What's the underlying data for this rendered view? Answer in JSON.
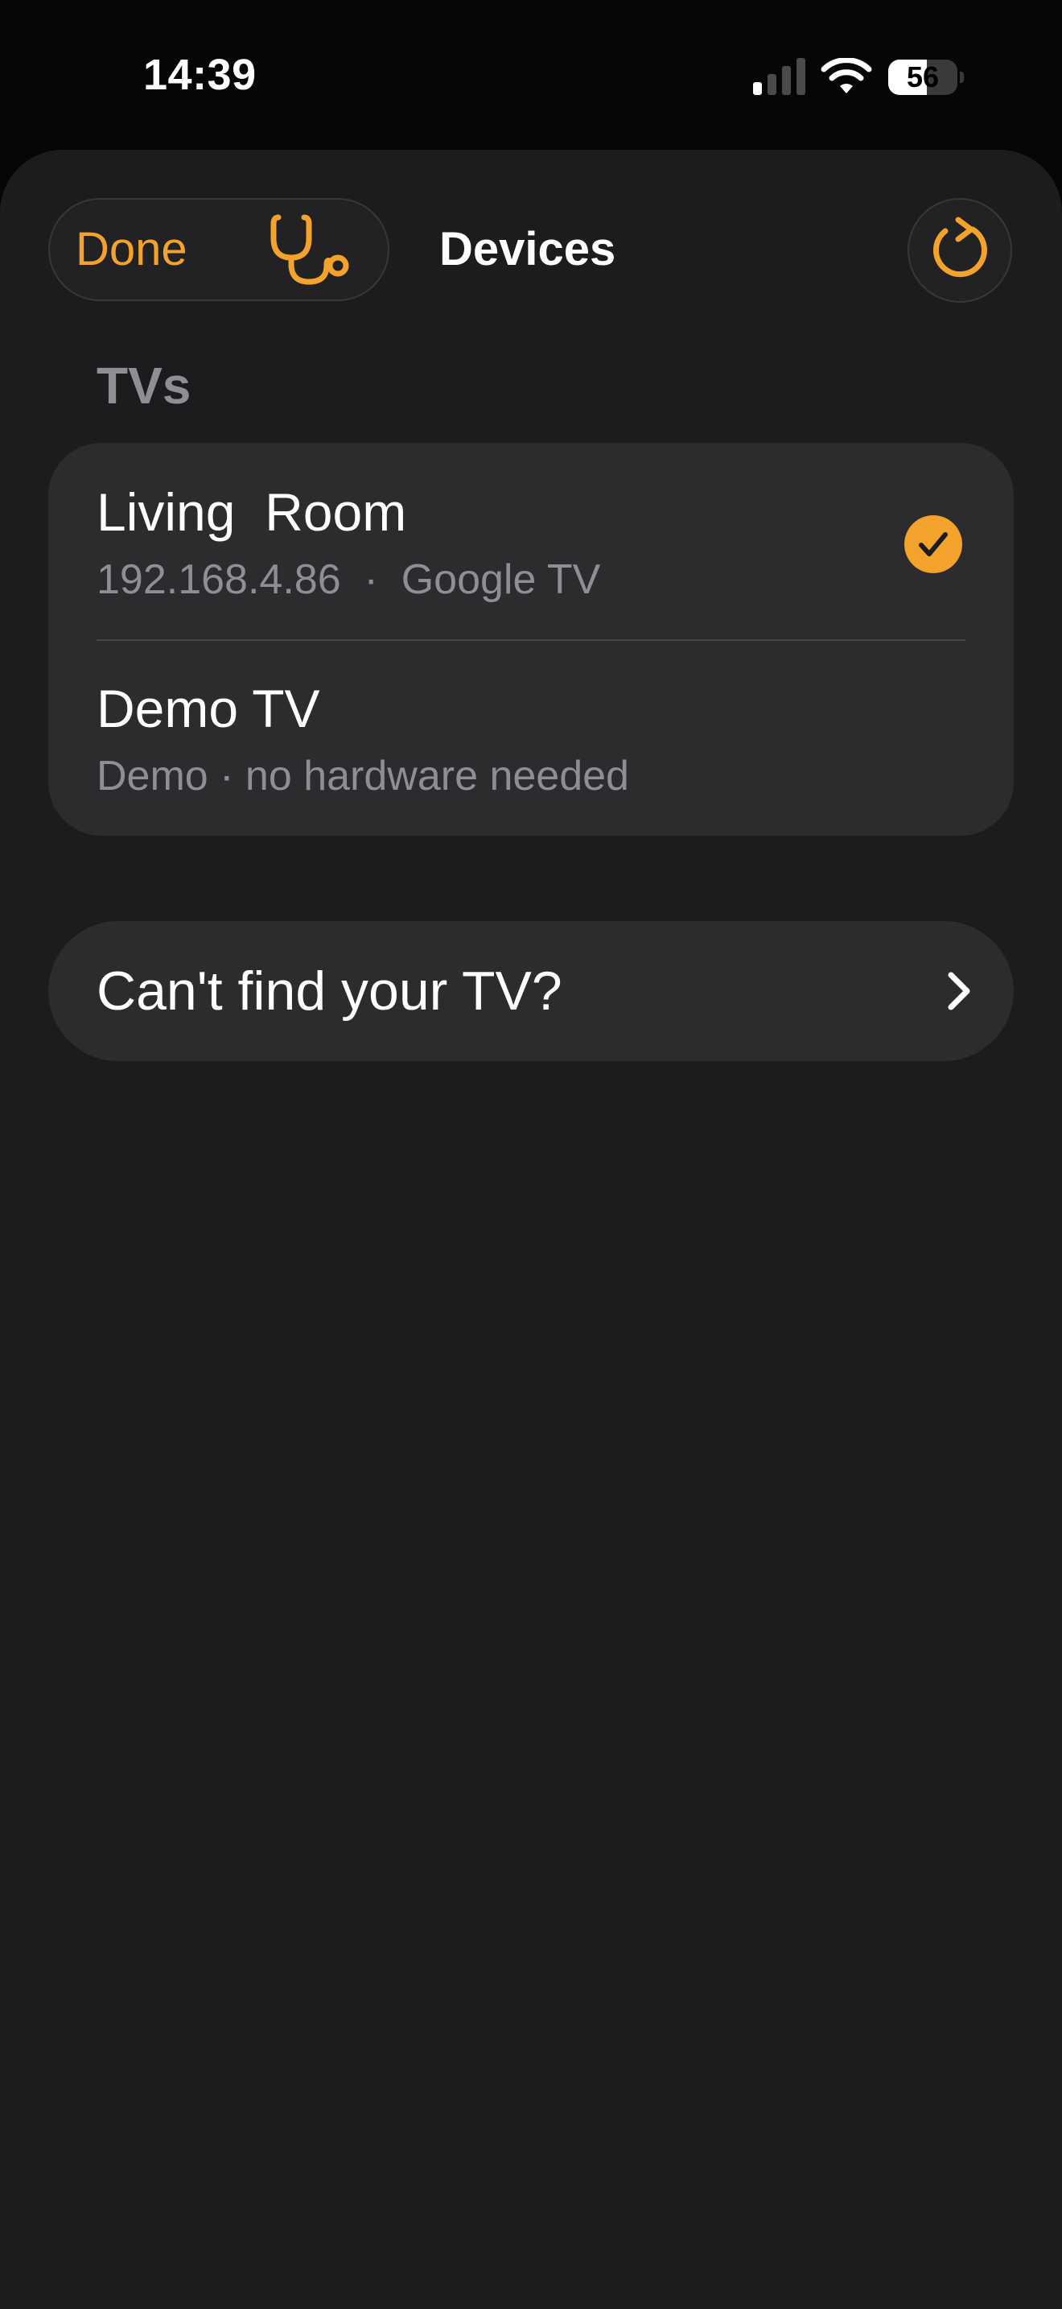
{
  "status_bar": {
    "time": "14:39",
    "battery_level": "56",
    "battery_fraction": 0.56,
    "icons": [
      "signal-icon",
      "wifi-icon",
      "battery-icon"
    ]
  },
  "header": {
    "done_label": "Done",
    "title": "Devices",
    "diagnostics_icon": "stethoscope-icon",
    "refresh_icon": "refresh-icon"
  },
  "tvs_section": {
    "header": "TVs",
    "items": [
      {
        "name": "Living  Room",
        "detail": "192.168.4.86  ·  Google TV",
        "selected": true
      },
      {
        "name": "Demo TV",
        "detail": "Demo · no hardware needed",
        "selected": false
      }
    ]
  },
  "help": {
    "label": "Can't find your TV?",
    "icon": "chevron-right-icon"
  },
  "colors": {
    "accent": "#f3a22c",
    "sheet_background": "#1c1c1e",
    "card_background": "#2c2c2e",
    "secondary_text": "#8e8e93"
  }
}
